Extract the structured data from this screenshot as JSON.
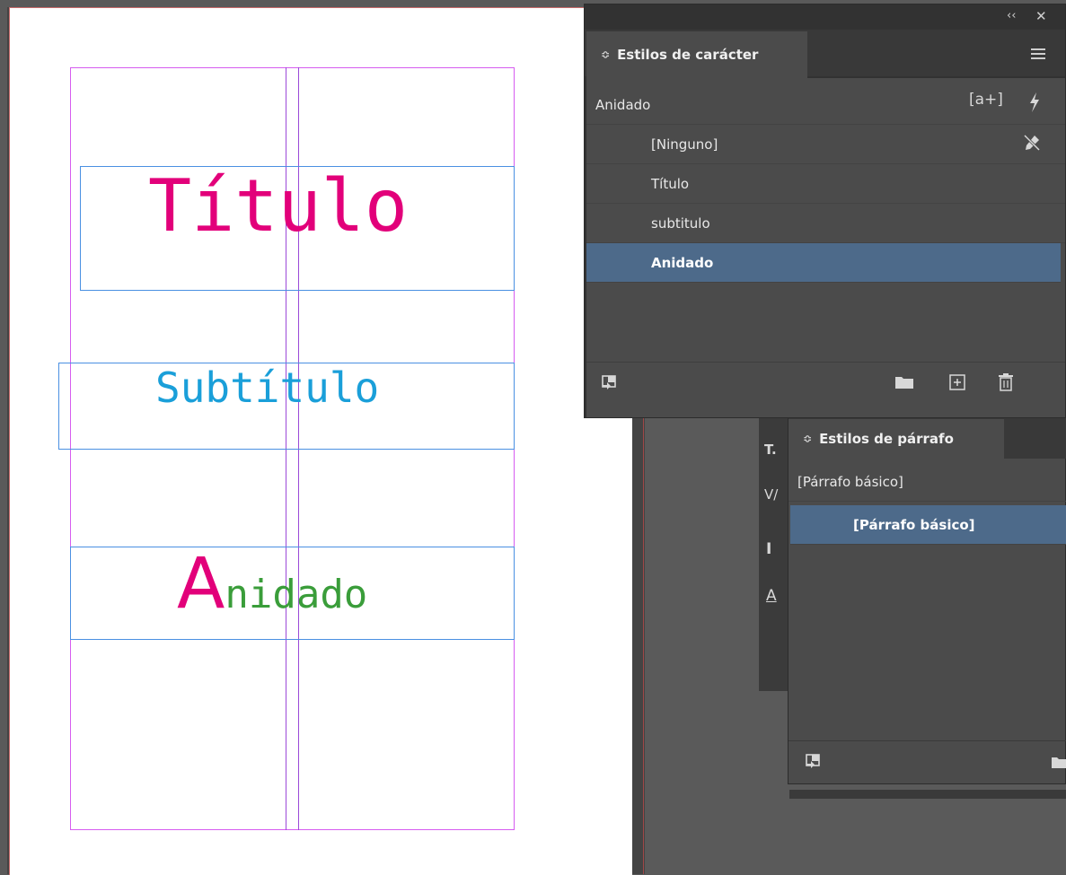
{
  "document": {
    "title_text": "Título",
    "subtitle_text": "Subtítulo",
    "nested_first_letter": "A",
    "nested_rest": "nidado",
    "colors": {
      "title": "#e2007a",
      "subtitle": "#1a9fd9",
      "nested_cap": "#e2007a",
      "nested_rest": "#3a9d3a"
    }
  },
  "char_styles_panel": {
    "header_controls": {
      "collapse": "‹‹",
      "close": "✕"
    },
    "tab_label": "Estilos de carácter",
    "menu_icon": "hamburger-menu-icon",
    "current_style": "Anidado",
    "current_controls": {
      "new_override": "[a+]",
      "quick_apply": "lightning-icon"
    },
    "items": [
      {
        "label": "[Ninguno]",
        "icon": "pen-strike-icon"
      },
      {
        "label": "Título"
      },
      {
        "label": "subtitulo"
      },
      {
        "label": "Anidado",
        "selected": true
      }
    ],
    "footer_icons": [
      "load-styles-icon",
      "folder-icon",
      "new-style-icon",
      "delete-icon"
    ]
  },
  "para_styles_panel": {
    "tab_label": "Estilos de párrafo",
    "current_style": "[Párrafo básico]",
    "items": [
      {
        "label": "[Párrafo básico]",
        "selected": true
      }
    ],
    "footer_icons": [
      "load-styles-icon",
      "folder-icon"
    ]
  },
  "tool_strip": {
    "labels": [
      "T.",
      "V/",
      "I",
      "A"
    ]
  }
}
